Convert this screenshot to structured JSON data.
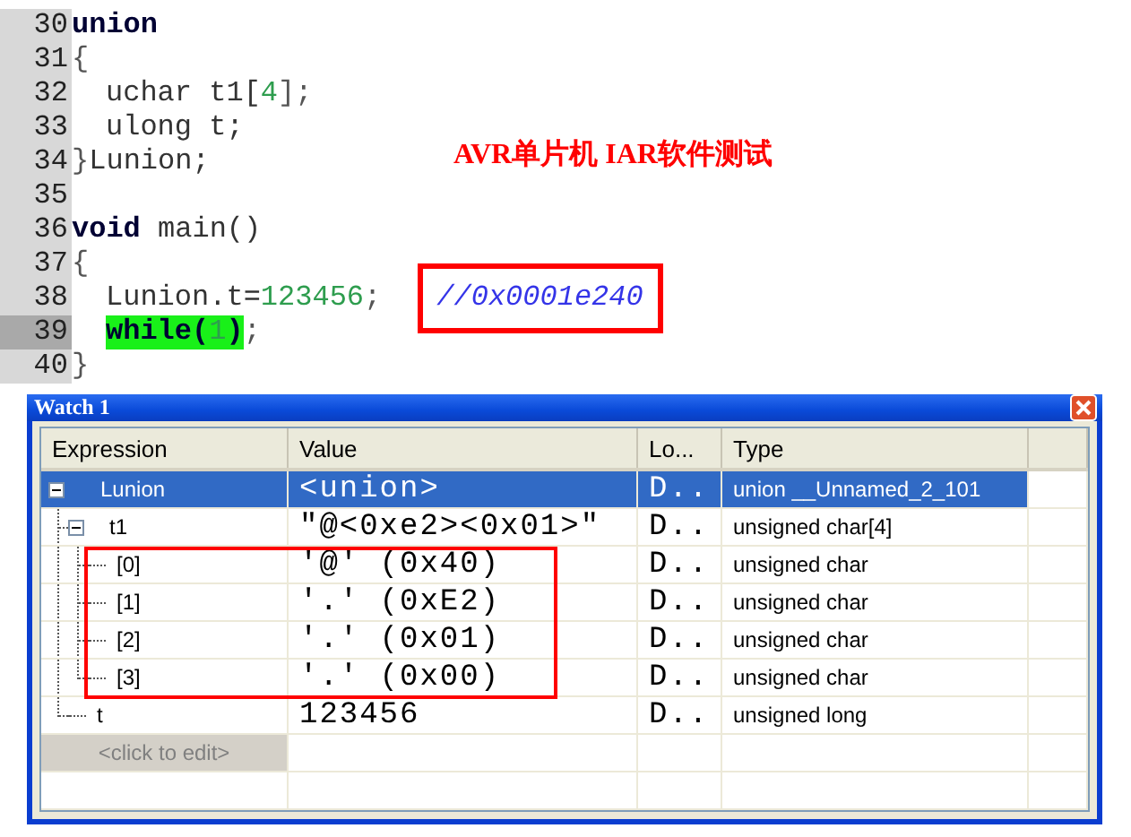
{
  "editor": {
    "lines": [
      {
        "number": "30",
        "current": false,
        "indent": false,
        "tokens": [
          {
            "kind": "keyword",
            "text": "union",
            "highlighted": false
          }
        ]
      },
      {
        "number": "31",
        "current": false,
        "indent": false,
        "tokens": [
          {
            "kind": "punct",
            "text": "{",
            "highlighted": false
          }
        ]
      },
      {
        "number": "32",
        "current": false,
        "indent": true,
        "tokens": [
          {
            "kind": "ident",
            "text": "uchar t1[",
            "highlighted": false
          },
          {
            "kind": "number",
            "text": "4",
            "highlighted": false
          },
          {
            "kind": "punct",
            "text": "];",
            "highlighted": false
          }
        ]
      },
      {
        "number": "33",
        "current": false,
        "indent": true,
        "tokens": [
          {
            "kind": "ident",
            "text": "ulong t;",
            "highlighted": false
          }
        ]
      },
      {
        "number": "34",
        "current": false,
        "indent": false,
        "tokens": [
          {
            "kind": "punct",
            "text": "}",
            "highlighted": false
          },
          {
            "kind": "ident",
            "text": "Lunion;",
            "highlighted": false
          }
        ]
      },
      {
        "number": "35",
        "current": false
      },
      {
        "number": "36",
        "current": false,
        "indent": false,
        "tokens": [
          {
            "kind": "keyword",
            "text": "void",
            "highlighted": false
          },
          {
            "kind": "ident",
            "text": " main()",
            "highlighted": false
          }
        ]
      },
      {
        "number": "37",
        "current": false,
        "indent": false,
        "tokens": [
          {
            "kind": "punct",
            "text": "{",
            "highlighted": false
          }
        ]
      },
      {
        "number": "38",
        "current": false,
        "indent": true,
        "tokens": [
          {
            "kind": "ident",
            "text": "Lunion.t=",
            "highlighted": false
          },
          {
            "kind": "number",
            "text": "123456",
            "highlighted": false
          },
          {
            "kind": "punct",
            "text": ";",
            "highlighted": false
          },
          {
            "kind": "boxed_comment",
            "text": "//0x0001e240",
            "highlighted": false
          }
        ]
      },
      {
        "number": "39",
        "current": true,
        "indent": true,
        "tokens": [
          {
            "kind": "keyword",
            "text": "while(",
            "highlighted": true
          },
          {
            "kind": "number",
            "text": "1",
            "highlighted": true
          },
          {
            "kind": "keyword",
            "text": ")",
            "highlighted": true
          },
          {
            "kind": "punct",
            "text": ";",
            "highlighted": false
          }
        ]
      },
      {
        "number": "40",
        "current": false,
        "indent": false,
        "tokens": [
          {
            "kind": "punct",
            "text": "}",
            "highlighted": false
          }
        ]
      }
    ],
    "caption": "AVR单片机 IAR软件测试"
  },
  "watch": {
    "title": "Watch 1",
    "columns": [
      "Expression",
      "Value",
      "Lo...",
      "Type"
    ],
    "rows": [
      {
        "expression": "Lunion",
        "value": "<union>",
        "location": "D..",
        "type": "union __Unnamed_2_101",
        "selected": true,
        "framed": false,
        "expanded": true,
        "children": [
          {
            "expression": "t1",
            "value": "\"@<0xe2><0x01>\"",
            "location": "D..",
            "type": "unsigned char[4]",
            "selected": false,
            "framed": false,
            "expanded": true,
            "children": [
              {
                "expression": "[0]",
                "value": "'@' (0x40)",
                "location": "D..",
                "type": "unsigned char",
                "selected": false,
                "framed": true
              },
              {
                "expression": "[1]",
                "value": "'.' (0xE2)",
                "location": "D..",
                "type": "unsigned char",
                "selected": false,
                "framed": true
              },
              {
                "expression": "[2]",
                "value": "'.' (0x01)",
                "location": "D..",
                "type": "unsigned char",
                "selected": false,
                "framed": true
              },
              {
                "expression": "[3]",
                "value": "'.' (0x00)",
                "location": "D..",
                "type": "unsigned char",
                "selected": false,
                "framed": true
              }
            ]
          },
          {
            "expression": "t",
            "value": "123456",
            "location": "D..",
            "type": "unsigned long",
            "selected": false,
            "framed": false
          }
        ]
      }
    ],
    "edit_placeholder": "<click to edit>"
  }
}
